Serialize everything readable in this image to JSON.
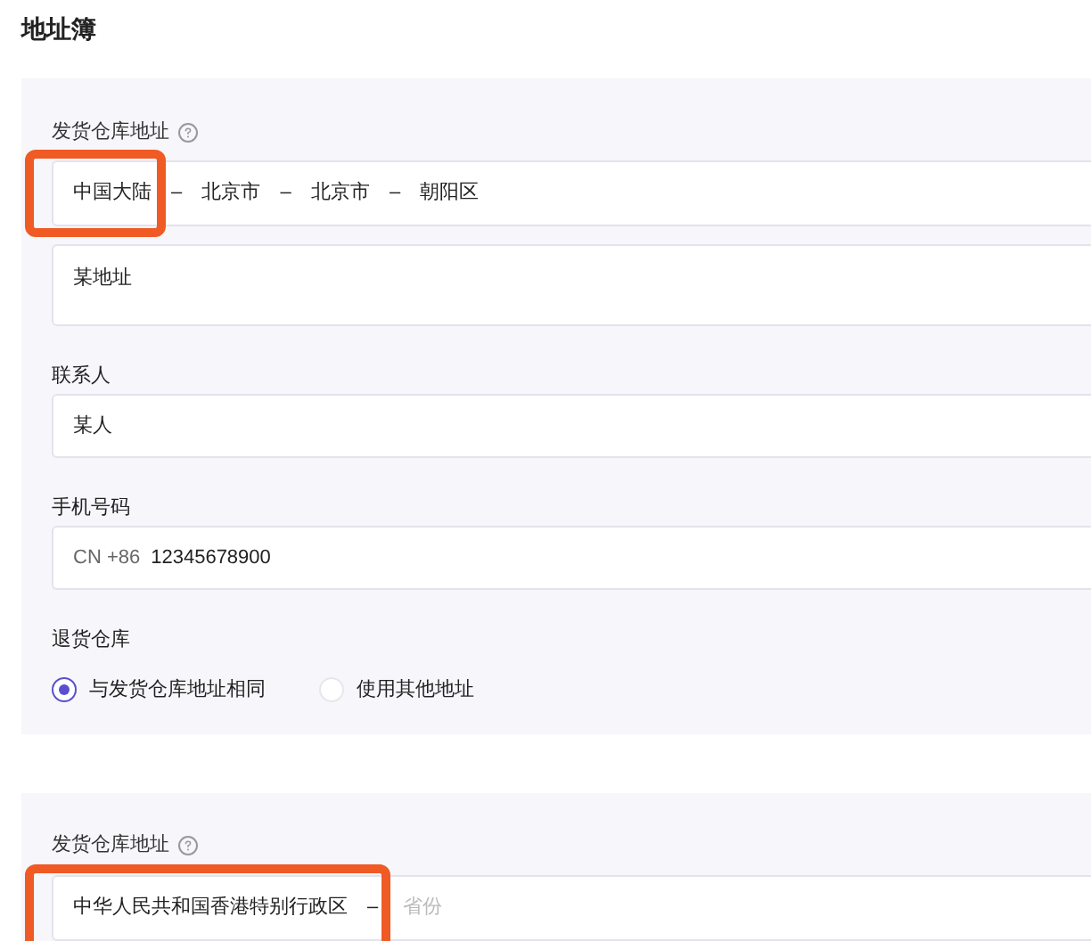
{
  "title": "地址簿",
  "cards": [
    {
      "address_label": "发货仓库地址",
      "region": {
        "value": "中国大陆 – 北京市 – 北京市 – 朝阳区",
        "highlighted": true
      },
      "street": "某地址",
      "contact_label": "联系人",
      "contact": "某人",
      "phone_label": "手机号码",
      "country_code": "CN +86",
      "phone": "12345678900",
      "return_label": "退货仓库",
      "return_options": [
        {
          "label": "与发货仓库地址相同",
          "selected": true
        },
        {
          "label": "使用其他地址",
          "selected": false
        }
      ]
    },
    {
      "address_label": "发货仓库地址",
      "region": {
        "value": "中华人民共和国香港特别行政区 –",
        "placeholder": "省份",
        "highlighted": true
      }
    }
  ]
}
